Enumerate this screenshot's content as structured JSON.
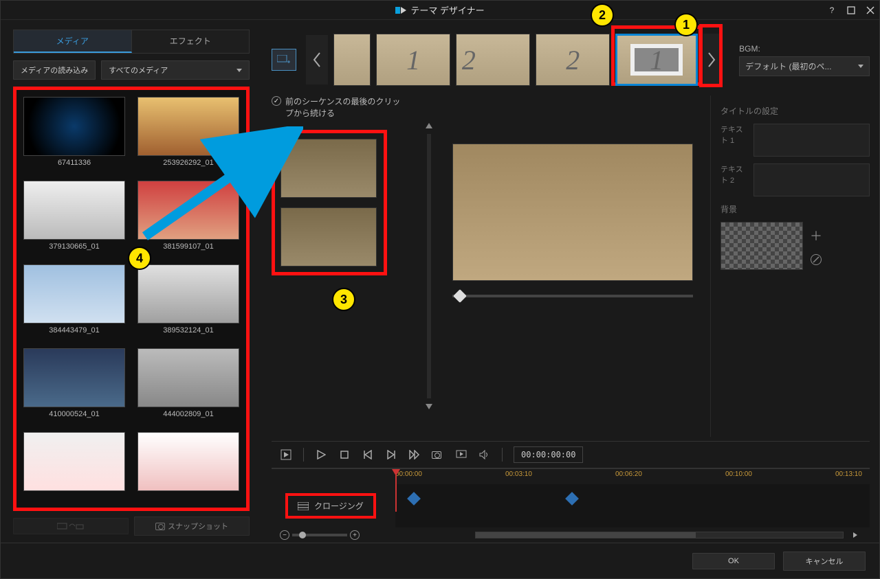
{
  "titlebar": {
    "title": "テーマ デザイナー"
  },
  "left": {
    "tabs": {
      "media": "メディア",
      "effects": "エフェクト"
    },
    "btn_import": "メディアの読み込み",
    "btn_filter": "すべてのメディア",
    "media": [
      {
        "label": "67411336"
      },
      {
        "label": "253926292_01"
      },
      {
        "label": "379130665_01"
      },
      {
        "label": "381599107_01"
      },
      {
        "label": "384443479_01"
      },
      {
        "label": "389532124_01"
      },
      {
        "label": "410000524_01"
      },
      {
        "label": "444002809_01"
      },
      {
        "label": ""
      },
      {
        "label": ""
      }
    ],
    "btn_snapshot": "スナップショット"
  },
  "right": {
    "seq_numbers": [
      "1",
      "2",
      "2",
      "1"
    ],
    "bgm_label": "BGM:",
    "bgm_value": "デフォルト (最初のペ...",
    "continue_label": "前のシーケンスの最後のクリップから続ける",
    "title_settings": "タイトルの設定",
    "text1": "テキスト 1",
    "text2": "テキスト 2",
    "bg": "背景",
    "timecode": "00:00:00:00",
    "ruler": [
      "00:00:00",
      "00:03:10",
      "00:06:20",
      "00:10:00",
      "00:13:10"
    ],
    "track_label": "クロージング"
  },
  "footer": {
    "ok": "OK",
    "cancel": "キャンセル"
  },
  "callouts": {
    "1": "1",
    "2": "2",
    "3": "3",
    "4": "4"
  }
}
